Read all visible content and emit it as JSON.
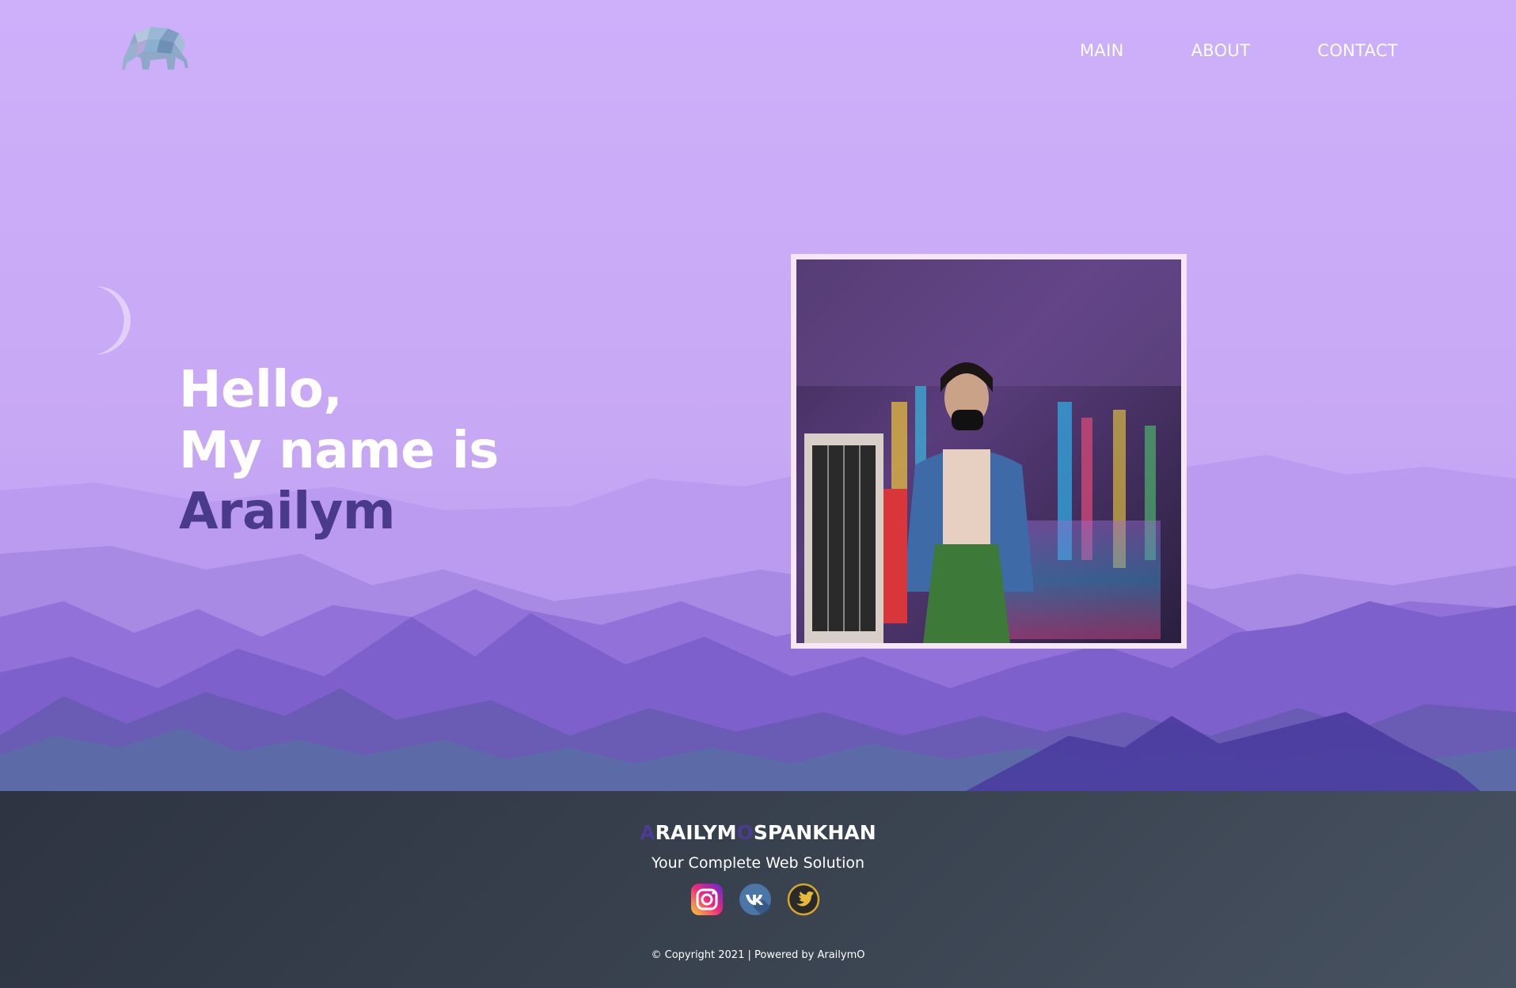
{
  "header": {
    "logo_icon": "elephant-logo-icon",
    "nav": {
      "main_label": "MAIN",
      "about_label": "ABOUT",
      "contact_label": "CONTACT"
    }
  },
  "hero": {
    "line1": "Hello,",
    "line2": "My name is",
    "name": "Arailym",
    "decor_icon": "crescent-moon-icon",
    "photo_icon": "profile-photo"
  },
  "footer": {
    "brand_first_letter": "A",
    "brand_part1": "RAILYM",
    "brand_separator": "O",
    "brand_part2": "SPANKHAN",
    "tagline": "Your Complete Web Solution",
    "socials": [
      "instagram-icon",
      "vk-icon",
      "twitter-icon"
    ],
    "copyright": "© Copyright 2021 | Powered by ArailymO"
  },
  "colors": {
    "sky": "#cdaffa",
    "name_accent": "#4a3a8c",
    "footer_bg": "#353c48"
  }
}
